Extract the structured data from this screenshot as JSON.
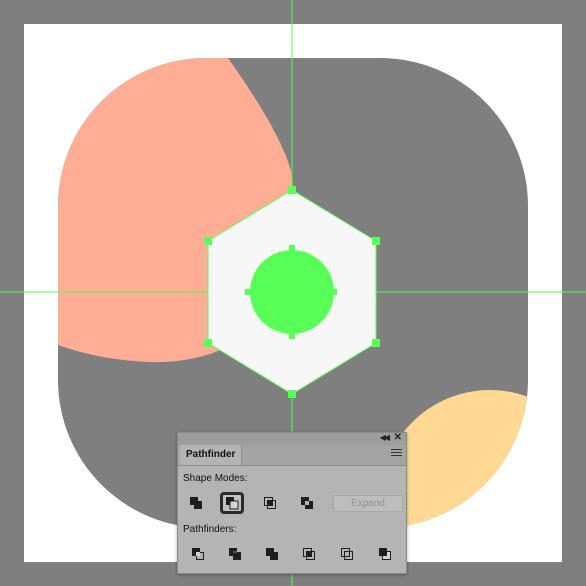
{
  "colors": {
    "workspace": "#7f7f7f",
    "artboard": "#ffffff",
    "base_shape": "#7f7f7f",
    "salmon_shape": "#ffad94",
    "yellow_shape": "#ffd994",
    "hexagon_fill": "#f7f7f7",
    "circle_fill": "#57ff57",
    "guides": "#4cff4c",
    "panel_bg": "#b4b4b4"
  },
  "panel": {
    "title": "Pathfinder",
    "shape_modes_label": "Shape Modes:",
    "pathfinders_label": "Pathfinders:",
    "expand_label": "Expand",
    "shape_mode_buttons": [
      {
        "icon": "unite-icon",
        "selected": false
      },
      {
        "icon": "minus-front-icon",
        "selected": true
      },
      {
        "icon": "intersect-icon",
        "selected": false
      },
      {
        "icon": "exclude-icon",
        "selected": false
      }
    ],
    "pathfinder_buttons": [
      {
        "icon": "divide-icon"
      },
      {
        "icon": "trim-icon"
      },
      {
        "icon": "merge-icon"
      },
      {
        "icon": "crop-icon"
      },
      {
        "icon": "outline-icon"
      },
      {
        "icon": "minus-back-icon"
      }
    ]
  }
}
